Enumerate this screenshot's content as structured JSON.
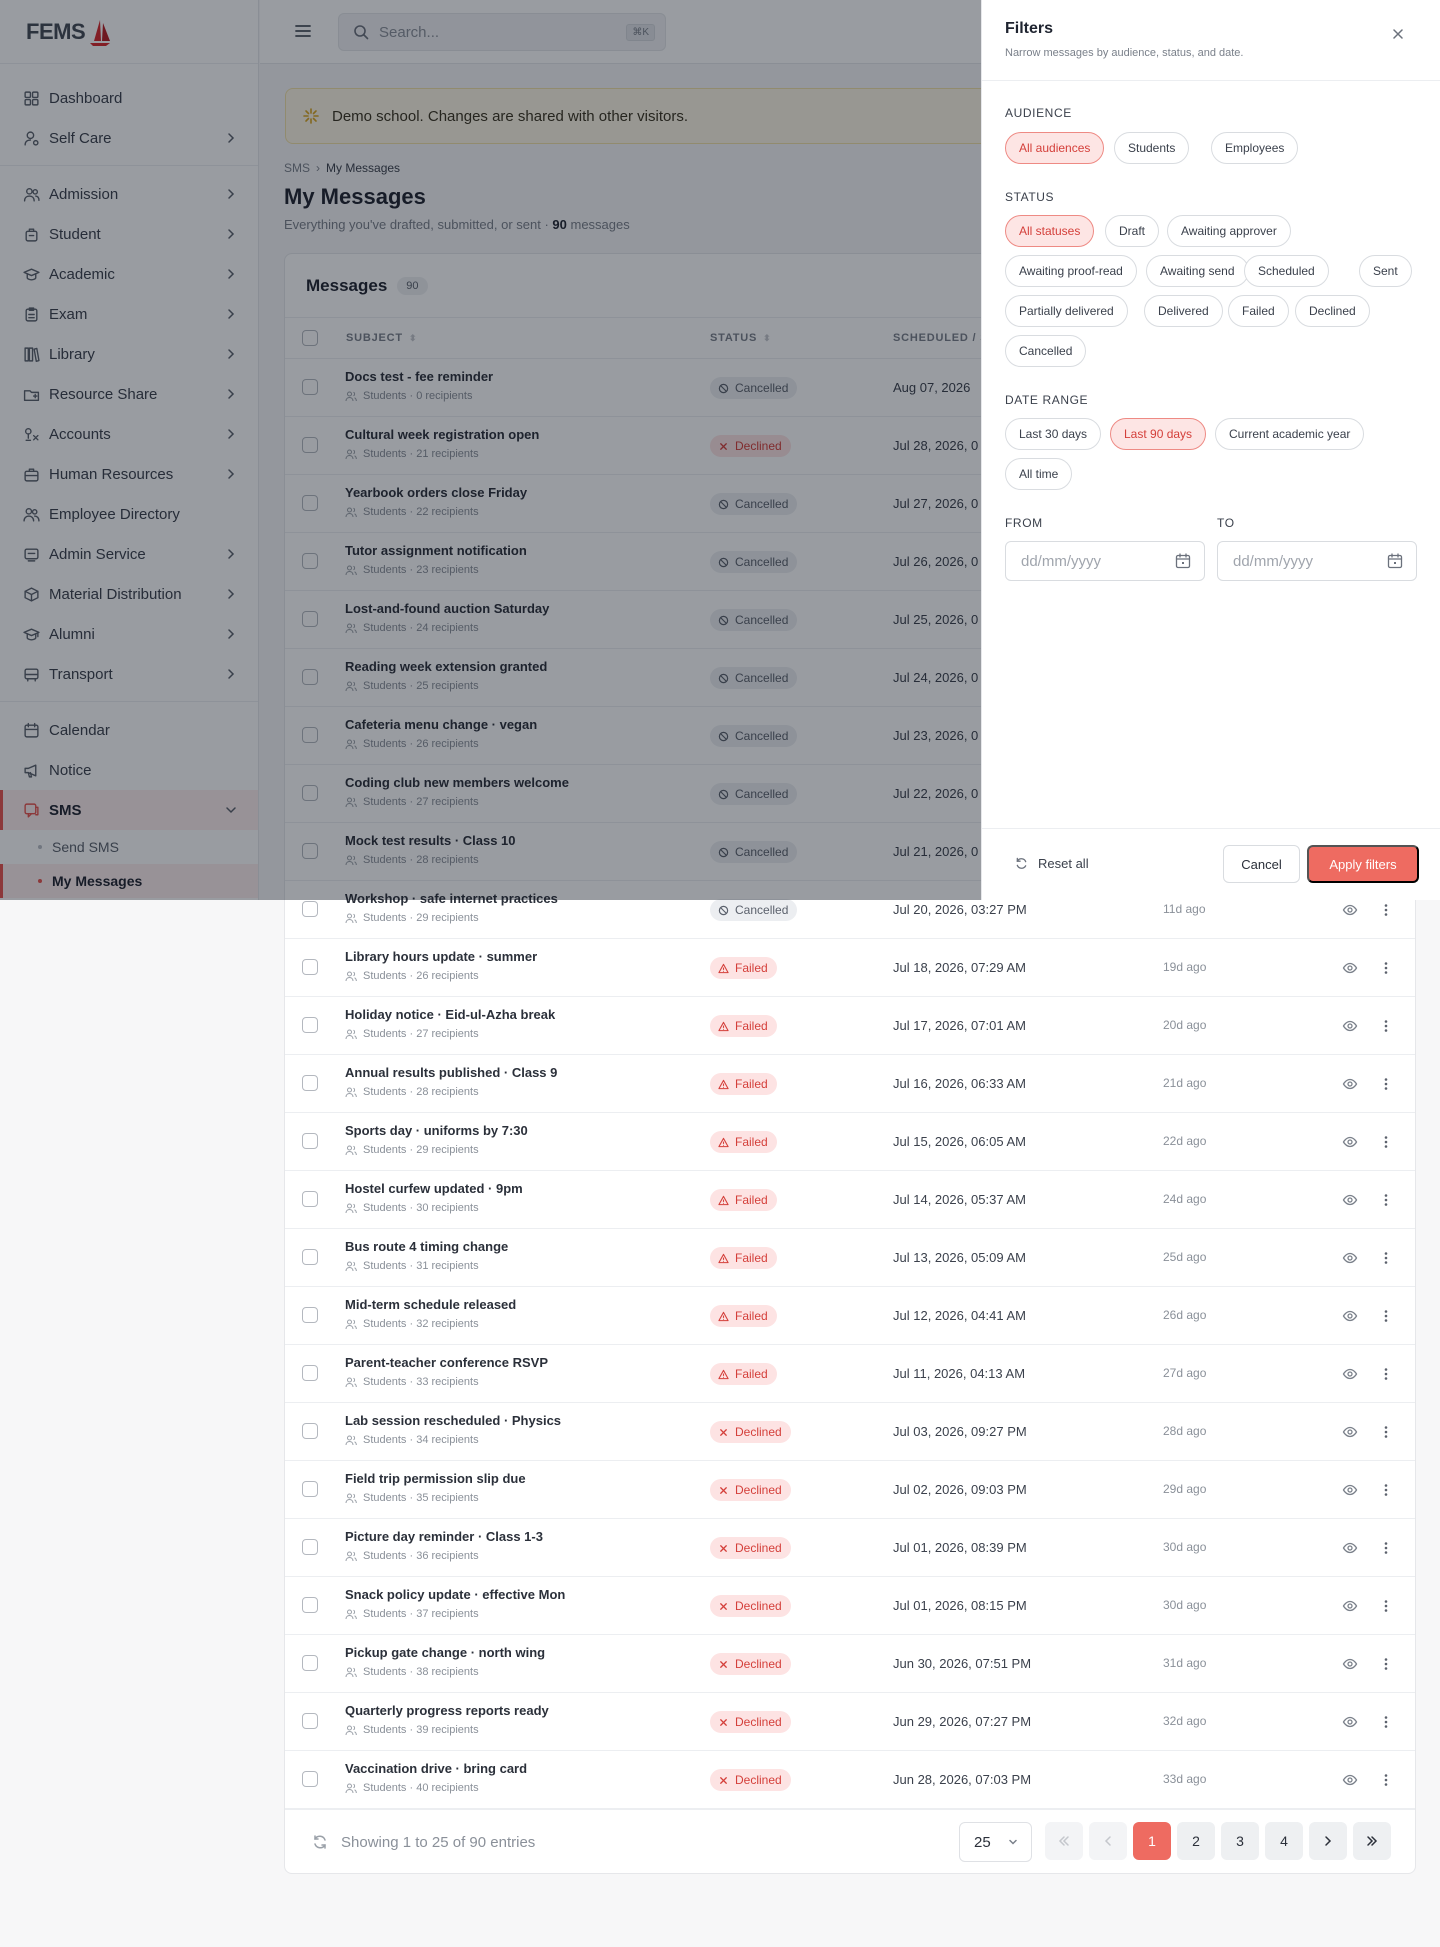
{
  "brand": {
    "name": "FEMS"
  },
  "sidebar": {
    "items": [
      {
        "label": "Dashboard",
        "icon": "grid-icon",
        "chevron": false
      },
      {
        "label": "Self Care",
        "icon": "user-gear-icon",
        "chevron": true
      },
      {
        "label": "Admission",
        "icon": "users-icon",
        "chevron": true
      },
      {
        "label": "Student",
        "icon": "student-icon",
        "chevron": true
      },
      {
        "label": "Academic",
        "icon": "graduation-cap-icon",
        "chevron": true
      },
      {
        "label": "Exam",
        "icon": "clipboard-icon",
        "chevron": true
      },
      {
        "label": "Library",
        "icon": "books-icon",
        "chevron": true
      },
      {
        "label": "Resource Share",
        "icon": "folder-share-icon",
        "chevron": true
      },
      {
        "label": "Accounts",
        "icon": "accounts-icon",
        "chevron": true
      },
      {
        "label": "Human Resources",
        "icon": "briefcase-icon",
        "chevron": true
      },
      {
        "label": "Employee Directory",
        "icon": "people-icon",
        "chevron": false
      },
      {
        "label": "Admin Service",
        "icon": "admin-icon",
        "chevron": true
      },
      {
        "label": "Material Distribution",
        "icon": "box-icon",
        "chevron": true
      },
      {
        "label": "Alumni",
        "icon": "cap-icon",
        "chevron": true
      },
      {
        "label": "Transport",
        "icon": "bus-icon",
        "chevron": true
      },
      {
        "label": "Calendar",
        "icon": "calendar-icon",
        "chevron": false
      },
      {
        "label": "Notice",
        "icon": "megaphone-icon",
        "chevron": false
      },
      {
        "label": "SMS",
        "icon": "sms-icon",
        "chevron": true
      }
    ],
    "sms_sub": [
      {
        "label": "Send SMS"
      },
      {
        "label": "My Messages"
      }
    ]
  },
  "topbar": {
    "search_placeholder": "Search...",
    "shortcut": "⌘K"
  },
  "banner": {
    "text": "Demo school. Changes are shared with other visitors."
  },
  "breadcrumb": {
    "root": "SMS",
    "sep": "›",
    "current": "My Messages"
  },
  "page": {
    "title": "My Messages",
    "subtitle_prefix": "Everything you've drafted, submitted, or sent · ",
    "subtitle_count": "90",
    "subtitle_suffix": " messages"
  },
  "table": {
    "title": "Messages",
    "count": "90",
    "headers": {
      "subject": "SUBJECT",
      "status": "STATUS",
      "scheduled": "SCHEDULED / S"
    },
    "rows": [
      {
        "subject": "Docs test - fee reminder",
        "meta": "Students · 0 recipients",
        "status": "Cancelled",
        "kind": "cancelled",
        "date": "Aug 07, 2026",
        "ago": ""
      },
      {
        "subject": "Cultural week registration open",
        "meta": "Students · 21 recipients",
        "status": "Declined",
        "kind": "declined",
        "date": "Jul 28, 2026, 0",
        "ago": ""
      },
      {
        "subject": "Yearbook orders close Friday",
        "meta": "Students · 22 recipients",
        "status": "Cancelled",
        "kind": "cancelled",
        "date": "Jul 27, 2026, 0",
        "ago": ""
      },
      {
        "subject": "Tutor assignment notification",
        "meta": "Students · 23 recipients",
        "status": "Cancelled",
        "kind": "cancelled",
        "date": "Jul 26, 2026, 0",
        "ago": ""
      },
      {
        "subject": "Lost-and-found auction Saturday",
        "meta": "Students · 24 recipients",
        "status": "Cancelled",
        "kind": "cancelled",
        "date": "Jul 25, 2026, 0",
        "ago": ""
      },
      {
        "subject": "Reading week extension granted",
        "meta": "Students · 25 recipients",
        "status": "Cancelled",
        "kind": "cancelled",
        "date": "Jul 24, 2026, 0",
        "ago": ""
      },
      {
        "subject": "Cafeteria menu change · vegan",
        "meta": "Students · 26 recipients",
        "status": "Cancelled",
        "kind": "cancelled",
        "date": "Jul 23, 2026, 0",
        "ago": ""
      },
      {
        "subject": "Coding club new members welcome",
        "meta": "Students · 27 recipients",
        "status": "Cancelled",
        "kind": "cancelled",
        "date": "Jul 22, 2026, 0",
        "ago": ""
      },
      {
        "subject": "Mock test results · Class 10",
        "meta": "Students · 28 recipients",
        "status": "Cancelled",
        "kind": "cancelled",
        "date": "Jul 21, 2026, 0",
        "ago": ""
      },
      {
        "subject": "Workshop · safe internet practices",
        "meta": "Students · 29 recipients",
        "status": "Cancelled",
        "kind": "cancelled",
        "date": "Jul 20, 2026, 03:27 PM",
        "ago": "11d ago"
      },
      {
        "subject": "Library hours update · summer",
        "meta": "Students · 26 recipients",
        "status": "Failed",
        "kind": "failed",
        "date": "Jul 18, 2026, 07:29 AM",
        "ago": "19d ago"
      },
      {
        "subject": "Holiday notice · Eid-ul-Azha break",
        "meta": "Students · 27 recipients",
        "status": "Failed",
        "kind": "failed",
        "date": "Jul 17, 2026, 07:01 AM",
        "ago": "20d ago"
      },
      {
        "subject": "Annual results published · Class 9",
        "meta": "Students · 28 recipients",
        "status": "Failed",
        "kind": "failed",
        "date": "Jul 16, 2026, 06:33 AM",
        "ago": "21d ago"
      },
      {
        "subject": "Sports day · uniforms by 7:30",
        "meta": "Students · 29 recipients",
        "status": "Failed",
        "kind": "failed",
        "date": "Jul 15, 2026, 06:05 AM",
        "ago": "22d ago"
      },
      {
        "subject": "Hostel curfew updated · 9pm",
        "meta": "Students · 30 recipients",
        "status": "Failed",
        "kind": "failed",
        "date": "Jul 14, 2026, 05:37 AM",
        "ago": "24d ago"
      },
      {
        "subject": "Bus route 4 timing change",
        "meta": "Students · 31 recipients",
        "status": "Failed",
        "kind": "failed",
        "date": "Jul 13, 2026, 05:09 AM",
        "ago": "25d ago"
      },
      {
        "subject": "Mid-term schedule released",
        "meta": "Students · 32 recipients",
        "status": "Failed",
        "kind": "failed",
        "date": "Jul 12, 2026, 04:41 AM",
        "ago": "26d ago"
      },
      {
        "subject": "Parent-teacher conference RSVP",
        "meta": "Students · 33 recipients",
        "status": "Failed",
        "kind": "failed",
        "date": "Jul 11, 2026, 04:13 AM",
        "ago": "27d ago"
      },
      {
        "subject": "Lab session rescheduled · Physics",
        "meta": "Students · 34 recipients",
        "status": "Declined",
        "kind": "declined",
        "date": "Jul 03, 2026, 09:27 PM",
        "ago": "28d ago"
      },
      {
        "subject": "Field trip permission slip due",
        "meta": "Students · 35 recipients",
        "status": "Declined",
        "kind": "declined",
        "date": "Jul 02, 2026, 09:03 PM",
        "ago": "29d ago"
      },
      {
        "subject": "Picture day reminder · Class 1-3",
        "meta": "Students · 36 recipients",
        "status": "Declined",
        "kind": "declined",
        "date": "Jul 01, 2026, 08:39 PM",
        "ago": "30d ago"
      },
      {
        "subject": "Snack policy update · effective Mon",
        "meta": "Students · 37 recipients",
        "status": "Declined",
        "kind": "declined",
        "date": "Jul 01, 2026, 08:15 PM",
        "ago": "30d ago"
      },
      {
        "subject": "Pickup gate change · north wing",
        "meta": "Students · 38 recipients",
        "status": "Declined",
        "kind": "declined",
        "date": "Jun 30, 2026, 07:51 PM",
        "ago": "31d ago"
      },
      {
        "subject": "Quarterly progress reports ready",
        "meta": "Students · 39 recipients",
        "status": "Declined",
        "kind": "declined",
        "date": "Jun 29, 2026, 07:27 PM",
        "ago": "32d ago"
      },
      {
        "subject": "Vaccination drive · bring card",
        "meta": "Students · 40 recipients",
        "status": "Declined",
        "kind": "declined",
        "date": "Jun 28, 2026, 07:03 PM",
        "ago": "33d ago"
      }
    ],
    "footer": {
      "showing": "Showing 1 to 25 of 90 entries",
      "per_page": "25",
      "pages": [
        "1",
        "2",
        "3",
        "4"
      ],
      "current_page": "1"
    }
  },
  "filters": {
    "title": "Filters",
    "subtitle": "Narrow messages by audience, status, and date.",
    "audience_label": "AUDIENCE",
    "audience": [
      "All audiences",
      "Students",
      "Employees"
    ],
    "audience_selected": "All audiences",
    "status_label": "STATUS",
    "statuses": [
      "All statuses",
      "Draft",
      "Awaiting approver",
      "Awaiting proof-read",
      "Awaiting send",
      "Scheduled",
      "Sent",
      "Partially delivered",
      "Delivered",
      "Failed",
      "Declined",
      "Cancelled"
    ],
    "status_selected": "All statuses",
    "date_label": "DATE RANGE",
    "date_ranges": [
      "Last 30 days",
      "Last 90 days",
      "Current academic year",
      "All time"
    ],
    "date_selected": "Last 90 days",
    "from_label": "FROM",
    "to_label": "TO",
    "from_placeholder": "dd/mm/yyyy",
    "to_placeholder": "dd/mm/yyyy",
    "reset_label": "Reset all",
    "cancel_label": "Cancel",
    "apply_label": "Apply filters"
  },
  "colors": {
    "accent": "#ee6b61",
    "danger": "#d43f3a",
    "banner_bg": "#fdf7e6"
  }
}
